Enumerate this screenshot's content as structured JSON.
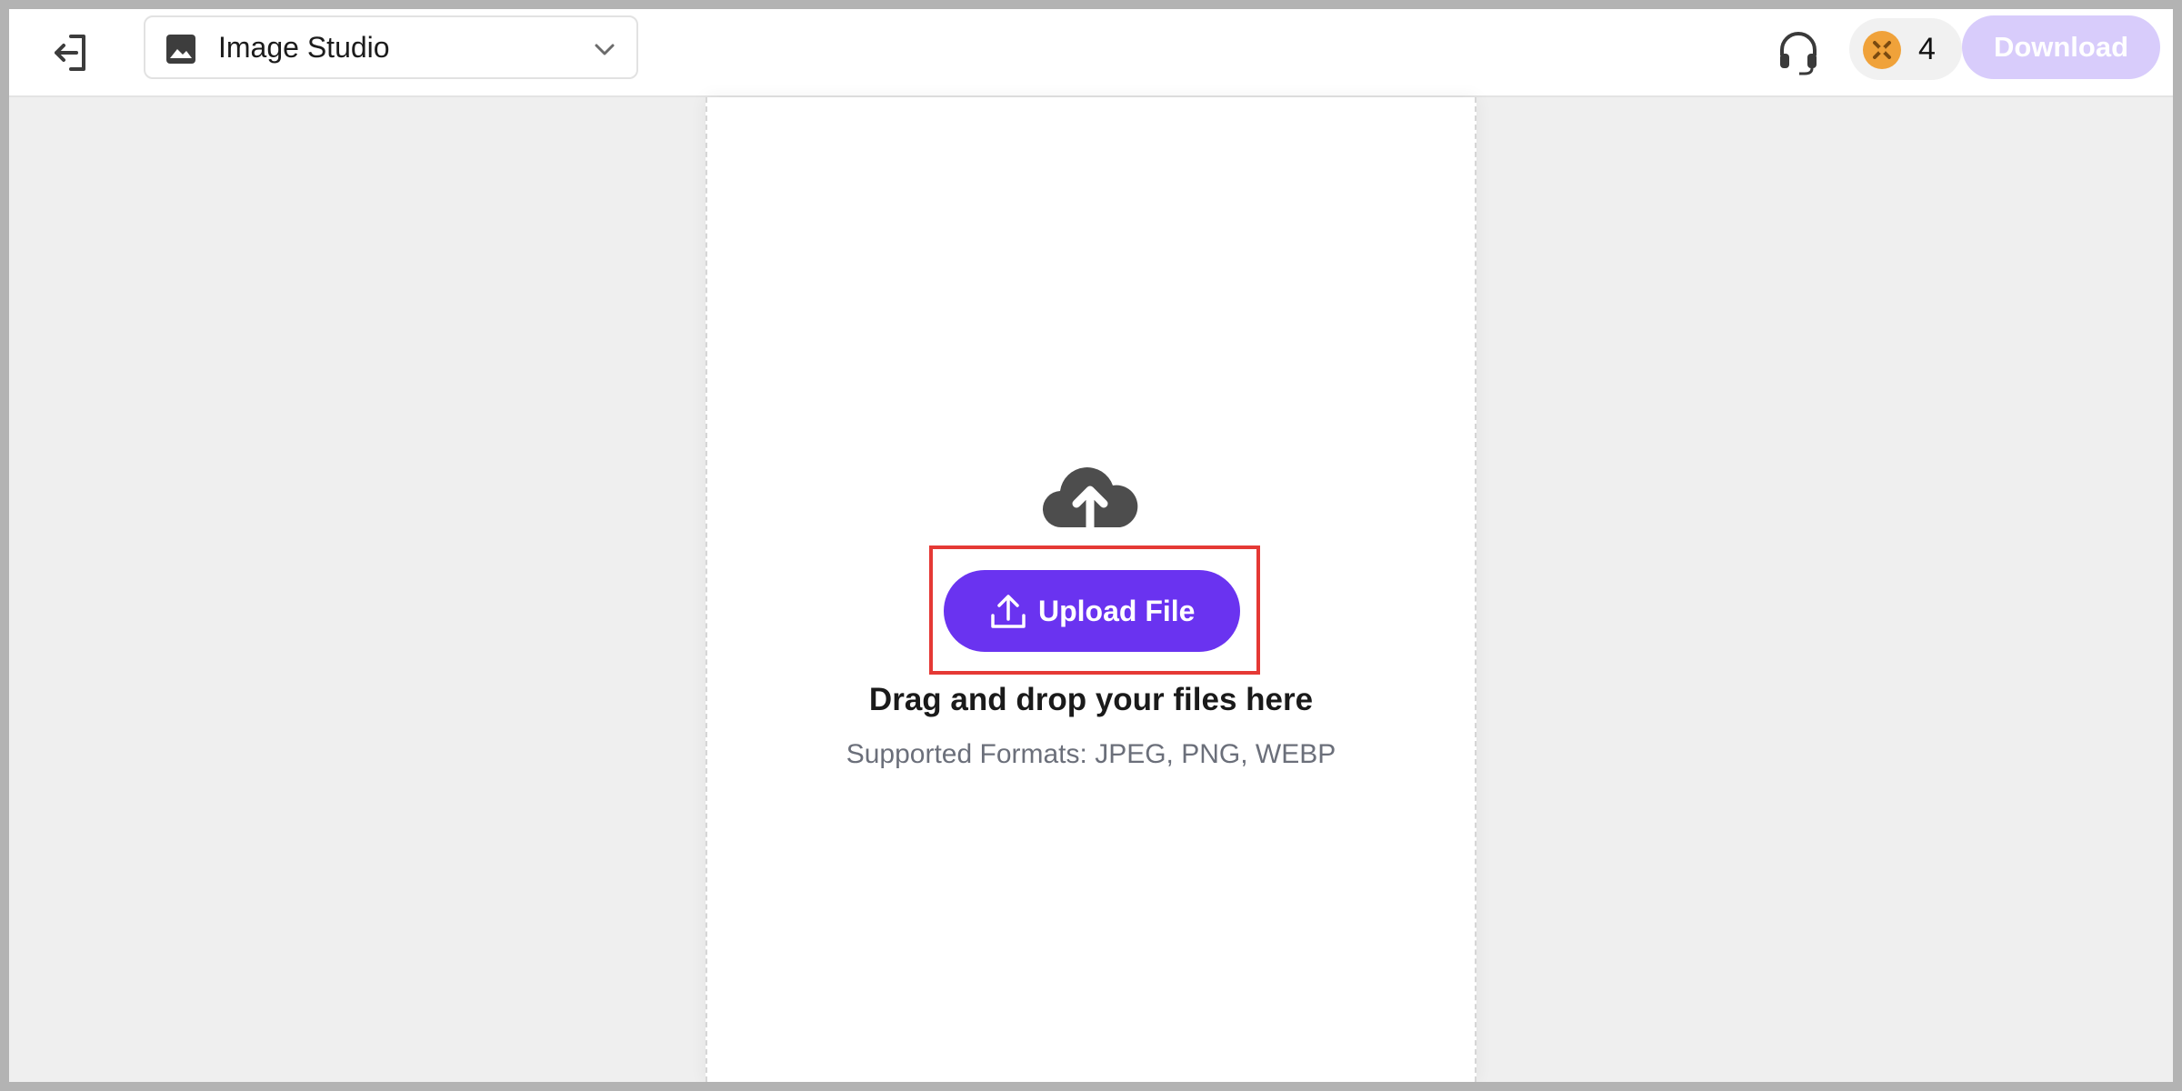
{
  "header": {
    "exit_icon": "exit-icon",
    "studio_selector": {
      "label": "Image Studio",
      "icon": "image-icon",
      "chevron": "chevron-down-icon"
    },
    "support_icon": "headset-icon",
    "credits": {
      "icon": "coin-icon",
      "count": "4"
    },
    "download_label": "Download"
  },
  "upload": {
    "icon": "cloud-upload-icon",
    "button_label": "Upload File",
    "button_icon": "upload-icon",
    "drop_text": "Drag and drop your files here",
    "formats_text": "Supported Formats: JPEG, PNG, WEBP"
  },
  "colors": {
    "accent": "#6a33f0",
    "download_disabled": "#d8ccfb",
    "highlight": "#e53935",
    "coin": "#f0a23a"
  }
}
